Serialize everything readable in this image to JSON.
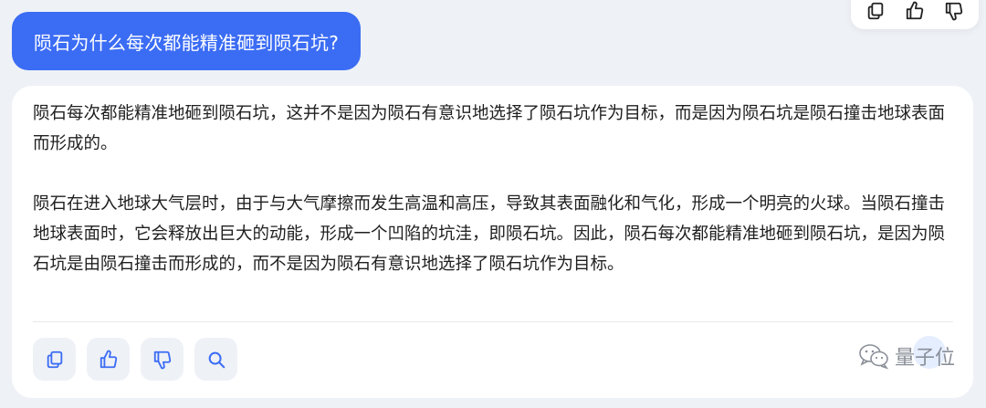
{
  "user_message": {
    "text": "陨石为什么每次都能精准砸到陨石坑?"
  },
  "answer": {
    "paragraphs": [
      "陨石每次都能精准地砸到陨石坑，这并不是因为陨石有意识地选择了陨石坑作为目标，而是因为陨石坑是陨石撞击地球表面而形成的。",
      "陨石在进入地球大气层时，由于与大气摩擦而发生高温和高压，导致其表面融化和气化，形成一个明亮的火球。当陨石撞击地球表面时，它会释放出巨大的动能，形成一个凹陷的坑洼，即陨石坑。因此，陨石每次都能精准地砸到陨石坑，是因为陨石坑是由陨石撞击而形成的，而不是因为陨石有意识地选择了陨石坑作为目标。"
    ]
  },
  "top_toolbar": {
    "icons": [
      "copy-icon",
      "thumbs-up-icon",
      "thumbs-down-icon"
    ]
  },
  "action_bar": {
    "icons": [
      "copy-icon",
      "thumbs-up-icon",
      "thumbs-down-icon",
      "search-icon"
    ]
  },
  "watermark": {
    "text": "量子位"
  },
  "colors": {
    "accent": "#3b6cf4",
    "background": "#eef1f6",
    "card": "#ffffff",
    "icon": "#3b6cf4"
  }
}
